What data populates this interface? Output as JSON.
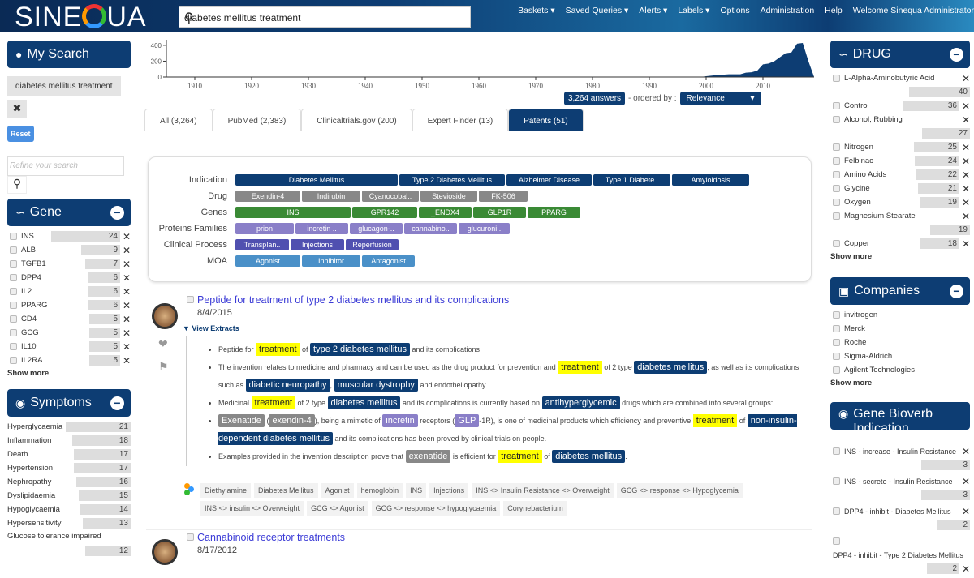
{
  "header": {
    "logo": "SINEQUA",
    "search_value": "diabetes mellitus treatment",
    "nav": [
      "Baskets ▾",
      "Saved Queries ▾",
      "Alerts ▾",
      "Labels ▾",
      "Options",
      "Administration",
      "Help",
      "Welcome Sinequa Administrator"
    ]
  },
  "my_search": {
    "title": "My Search",
    "chip": "diabetes mellitus treatment",
    "reset": "Reset",
    "refine_placeholder": "Refine your search"
  },
  "gene": {
    "title": "Gene",
    "items": [
      {
        "label": "INS",
        "count": 24
      },
      {
        "label": "ALB",
        "count": 9
      },
      {
        "label": "TGFB1",
        "count": 7
      },
      {
        "label": "DPP4",
        "count": 6
      },
      {
        "label": "IL2",
        "count": 6
      },
      {
        "label": "PPARG",
        "count": 6
      },
      {
        "label": "CD4",
        "count": 5
      },
      {
        "label": "GCG",
        "count": 5
      },
      {
        "label": "IL10",
        "count": 5
      },
      {
        "label": "IL2RA",
        "count": 5
      }
    ],
    "show_more": "Show more"
  },
  "symptoms": {
    "title": "Symptoms",
    "items": [
      {
        "label": "Hyperglycaemia",
        "count": 21
      },
      {
        "label": "Inflammation",
        "count": 18
      },
      {
        "label": "Death",
        "count": 17
      },
      {
        "label": "Hypertension",
        "count": 17
      },
      {
        "label": "Nephropathy",
        "count": 16
      },
      {
        "label": "Dyslipidaemia",
        "count": 15
      },
      {
        "label": "Hypoglycaemia",
        "count": 14
      },
      {
        "label": "Hypersensitivity",
        "count": 13
      },
      {
        "label": "Glucose tolerance impaired",
        "count": 12
      }
    ]
  },
  "drug": {
    "title": "DRUG",
    "items": [
      {
        "label": "L-Alpha-Aminobutyric Acid",
        "count": 40,
        "wrap": true
      },
      {
        "label": "Control",
        "count": 36
      },
      {
        "label": "Alcohol, Rubbing",
        "count": 27,
        "wrap": true
      },
      {
        "label": "Nitrogen",
        "count": 25
      },
      {
        "label": "Felbinac",
        "count": 24
      },
      {
        "label": "Amino Acids",
        "count": 22
      },
      {
        "label": "Glycine",
        "count": 21
      },
      {
        "label": "Oxygen",
        "count": 19
      },
      {
        "label": "Magnesium Stearate",
        "count": 19,
        "wrap": true
      },
      {
        "label": "Copper",
        "count": 18
      }
    ],
    "show_more": "Show more"
  },
  "companies": {
    "title": "Companies",
    "items": [
      "invitrogen",
      "Merck",
      "Roche",
      "Sigma-Aldrich",
      "Agilent Technologies"
    ],
    "show_more": "Show more"
  },
  "bioverb": {
    "title": "Gene Bioverb Indication",
    "items": [
      {
        "label": "INS - increase - Insulin Resistance",
        "count": 3
      },
      {
        "label": "INS - secrete - Insulin Resistance",
        "count": 3
      },
      {
        "label": "DPP4 - inhibit - Diabetes Mellitus",
        "count": 2
      },
      {
        "label": "DPP4 - inhibit - Type 2 Diabetes Mellitus",
        "count": 2
      }
    ]
  },
  "chart_data": {
    "type": "area",
    "title": "",
    "xlabel": "",
    "ylabel": "",
    "xlim": [
      1905,
      2019
    ],
    "ylim": [
      0,
      450
    ],
    "xticks": [
      1910,
      1920,
      1930,
      1940,
      1950,
      1960,
      1970,
      1980,
      1990,
      2000,
      2010
    ],
    "yticks": [
      0,
      200,
      400
    ],
    "x": [
      1905,
      1999,
      2000,
      2002,
      2004,
      2006,
      2007,
      2008,
      2009,
      2010,
      2011,
      2012,
      2013,
      2014,
      2015,
      2016,
      2017,
      2018,
      2019
    ],
    "y": [
      0,
      0,
      10,
      25,
      35,
      35,
      55,
      60,
      80,
      160,
      170,
      200,
      250,
      300,
      310,
      420,
      430,
      200,
      0
    ],
    "color": "#0d3d73"
  },
  "results_bar": {
    "answers": "3,264 answers",
    "ordered_by": "- ordered by :",
    "order_value": "Relevance"
  },
  "tabs": [
    {
      "label": "All (3,264)"
    },
    {
      "label": "PubMed (2,383)"
    },
    {
      "label": "Clinicaltrials.gov (200)"
    },
    {
      "label": "Expert Finder (13)"
    },
    {
      "label": "Patents (51)",
      "active": true
    }
  ],
  "entities": [
    {
      "label": "Indication",
      "color": "#0d3d73",
      "items": [
        [
          "Diabetes Mellitus",
          200
        ],
        [
          "Type 2 Diabetes Mellitus",
          130
        ],
        [
          "Alzheimer Disease",
          105
        ],
        [
          "Type 1 Diabete..",
          95
        ],
        [
          "Amyloidosis",
          95
        ]
      ]
    },
    {
      "label": "Drug",
      "color": "#888888",
      "items": [
        [
          "Exendin-4",
          80
        ],
        [
          "Indirubin",
          72
        ],
        [
          "Cyanocobal..",
          70
        ],
        [
          "Stevioside",
          70
        ],
        [
          "FK-506",
          60
        ]
      ]
    },
    {
      "label": "Genes",
      "color": "#3a8a35",
      "items": [
        [
          "INS",
          142
        ],
        [
          "GPR142",
          80
        ],
        [
          "_ENDX4",
          65
        ],
        [
          "GLP1R",
          65
        ],
        [
          "PPARG",
          65
        ]
      ]
    },
    {
      "label": "Proteins Families",
      "color": "#8a7fc8",
      "items": [
        [
          "prion",
          72
        ],
        [
          "incretin ..",
          65
        ],
        [
          "glucagon-..",
          65
        ],
        [
          "cannabino..",
          65
        ],
        [
          "glucuroni..",
          63
        ]
      ]
    },
    {
      "label": "Clinical Process",
      "color": "#5050b0",
      "items": [
        [
          "Transplan..",
          66
        ],
        [
          "Injections",
          66
        ],
        [
          "Reperfusion",
          65
        ]
      ]
    },
    {
      "label": "MOA",
      "color": "#4a90c8",
      "items": [
        [
          "Agonist",
          80
        ],
        [
          "Inhibitor",
          72
        ],
        [
          "Antagonist",
          65
        ]
      ]
    }
  ],
  "result1": {
    "title": "Peptide for treatment of type 2 diabetes mellitus and its complications",
    "date": "8/4/2015",
    "view_extracts": "▼ View Extracts",
    "extracts": [
      [
        [
          "t",
          "Peptide for "
        ],
        [
          "hl",
          "treatment"
        ],
        [
          "t",
          " of "
        ],
        [
          "en",
          "type 2 diabetes mellitus"
        ],
        [
          "t",
          " and its complications"
        ]
      ],
      [
        [
          "t",
          "The invention relates to medicine and pharmacy and can be used as the drug product for prevention and "
        ],
        [
          "hl",
          "treatment"
        ],
        [
          "t",
          " of 2 type "
        ],
        [
          "en",
          "diabetes mellitus"
        ],
        [
          "t",
          ", as well as its complications such as "
        ],
        [
          "en",
          "diabetic neuropathy"
        ],
        [
          "t",
          ", "
        ],
        [
          "en",
          "muscular dystrophy"
        ],
        [
          "t",
          " and endotheliopathy."
        ]
      ],
      [
        [
          "t",
          "Medicinal "
        ],
        [
          "hl",
          "treatment"
        ],
        [
          "t",
          " of 2 type "
        ],
        [
          "en",
          "diabetes mellitus"
        ],
        [
          "t",
          " and its complications is currently based on "
        ],
        [
          "en",
          "antihyperglycemic"
        ],
        [
          "t",
          " drugs which are combined into several groups:"
        ]
      ],
      [
        [
          "dr",
          "Exenatide"
        ],
        [
          "t",
          " ("
        ],
        [
          "dr",
          "exendin-4"
        ],
        [
          "t",
          "), being a mimetic of "
        ],
        [
          "pr",
          "incretin"
        ],
        [
          "t",
          " receptors ("
        ],
        [
          "pr",
          "GLP"
        ],
        [
          "t",
          "-1R), is one of medicinal products which efficiency and preventive "
        ],
        [
          "hl",
          "treatment"
        ],
        [
          "t",
          " of "
        ],
        [
          "en",
          "non-insulin-dependent diabetes mellitus"
        ],
        [
          "t",
          " and its complications has been proved by clinical trials on people."
        ]
      ],
      [
        [
          "t",
          "Examples provided in the invention description prove that "
        ],
        [
          "dr",
          "exenatide"
        ],
        [
          "t",
          " is efficient for "
        ],
        [
          "hl",
          "treatment"
        ],
        [
          "t",
          " of "
        ],
        [
          "en",
          "diabetes mellitus"
        ],
        [
          "t",
          "."
        ]
      ]
    ],
    "tags": [
      "Diethylamine",
      "Diabetes Mellitus",
      "Agonist",
      "hemoglobin",
      "INS",
      "Injections",
      "INS <> Insulin Resistance <> Overweight",
      "GCG <> response <> Hypoglycemia",
      "INS <> insulin <> Overweight",
      "GCG <> Agonist",
      "GCG <> response <> hypoglycaemia",
      "Corynebacterium"
    ]
  },
  "result2": {
    "title": "Cannabinoid receptor treatments",
    "date": "8/17/2012"
  }
}
